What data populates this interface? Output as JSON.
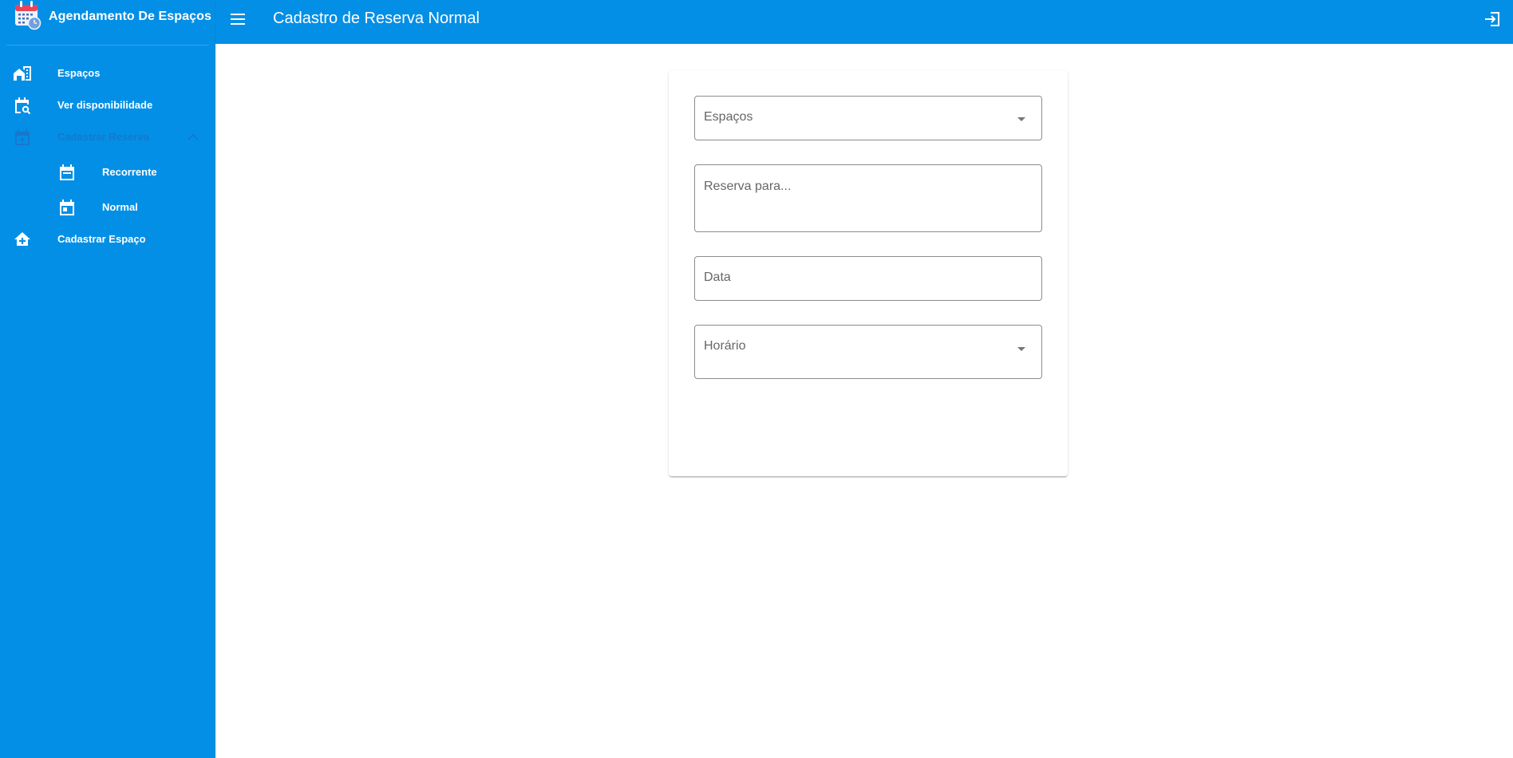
{
  "sidebar": {
    "brand_title": "Agendamento De Espaços",
    "brand_icon": "calendar-clock-icon",
    "items": [
      {
        "label": "Espaços",
        "icon": "buildings-icon"
      },
      {
        "label": "Ver disponibilidade",
        "icon": "calendar-search-icon"
      },
      {
        "label": "Cadastrar Reserva",
        "icon": "calendar-plus-icon",
        "expanded": true,
        "disabled": true
      },
      {
        "label": "Recorrente",
        "icon": "calendar-range-icon",
        "sub": true
      },
      {
        "label": "Normal",
        "icon": "calendar-today-icon",
        "sub": true
      },
      {
        "label": "Cadastrar Espaço",
        "icon": "home-plus-icon"
      }
    ]
  },
  "appbar": {
    "title": "Cadastro de Reserva Normal",
    "menu_icon": "menu-icon",
    "logout_icon": "logout-icon"
  },
  "form": {
    "espacos": {
      "label": "Espaços",
      "value": "",
      "type": "select"
    },
    "reserva_para": {
      "label": "Reserva para...",
      "value": "",
      "type": "textarea"
    },
    "data": {
      "label": "Data",
      "value": "",
      "type": "text"
    },
    "horario": {
      "label": "Horário",
      "value": "",
      "type": "select"
    }
  },
  "colors": {
    "primary": "#038fe6",
    "field_border": "#8c8c8c",
    "placeholder": "#666666"
  }
}
